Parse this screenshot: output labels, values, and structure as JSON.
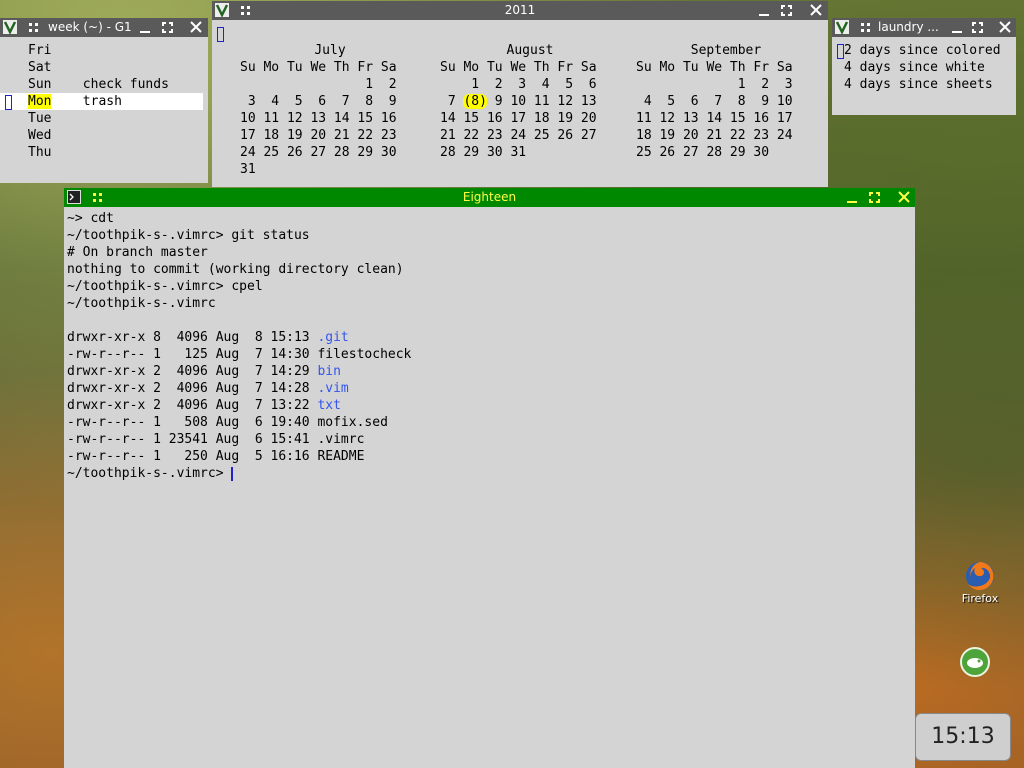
{
  "week_window": {
    "title": "week (~) - G1",
    "rows": [
      {
        "day": "Fri",
        "task": ""
      },
      {
        "day": "Sat",
        "task": ""
      },
      {
        "day": "Sun",
        "task": "check funds"
      },
      {
        "day": "Mon",
        "task": "trash"
      },
      {
        "day": "Tue",
        "task": ""
      },
      {
        "day": "Wed",
        "task": ""
      },
      {
        "day": "Thu",
        "task": ""
      }
    ]
  },
  "calendar_window": {
    "title": "2011",
    "weekday_header": "Su Mo Tu We Th Fr Sa",
    "months": [
      {
        "name": "July",
        "weeks": [
          "                1  2",
          " 3  4  5  6  7  8  9",
          "10 11 12 13 14 15 16",
          "17 18 19 20 21 22 23",
          "24 25 26 27 28 29 30",
          "31"
        ]
      },
      {
        "name": "August",
        "weeks": [
          "    1  2  3  4  5  6",
          " 7 ",
          "14 15 16 17 18 19 20",
          "21 22 23 24 25 26 27",
          "28 29 30 31"
        ]
      },
      {
        "name": "September",
        "weeks": [
          "             1  2  3",
          " 4  5  6  7  8  9 10",
          "11 12 13 14 15 16 17",
          "18 19 20 21 22 23 24",
          "25 26 27 28 29 30"
        ]
      }
    ],
    "today_marker": "(8)",
    "august_week2_rest": " 9 10 11 12 13"
  },
  "laundry_window": {
    "title": "laundry ...",
    "lines": [
      "2 days since colored",
      "4 days since white",
      "4 days since sheets"
    ]
  },
  "terminal": {
    "title": "Eighteen",
    "lines": [
      "~> cdt",
      "~/toothpik-s-.vimrc> git status",
      "# On branch master",
      "nothing to commit (working directory clean)",
      "~/toothpik-s-.vimrc> cpel",
      "~/toothpik-s-.vimrc",
      ""
    ],
    "listing": [
      {
        "meta": "drwxr-xr-x 8  4096 Aug  8 15:13 ",
        "name": ".git",
        "dir": true
      },
      {
        "meta": "-rw-r--r-- 1   125 Aug  7 14:30 ",
        "name": "filestocheck",
        "dir": false
      },
      {
        "meta": "drwxr-xr-x 2  4096 Aug  7 14:29 ",
        "name": "bin",
        "dir": true
      },
      {
        "meta": "drwxr-xr-x 2  4096 Aug  7 14:28 ",
        "name": ".vim",
        "dir": true
      },
      {
        "meta": "drwxr-xr-x 2  4096 Aug  7 13:22 ",
        "name": "txt",
        "dir": true
      },
      {
        "meta": "-rw-r--r-- 1   508 Aug  6 19:40 ",
        "name": "mofix.sed",
        "dir": false
      },
      {
        "meta": "-rw-r--r-- 1 23541 Aug  6 15:41 ",
        "name": ".vimrc",
        "dir": false
      },
      {
        "meta": "-rw-r--r-- 1   250 Aug  5 16:16 ",
        "name": "README",
        "dir": false
      }
    ],
    "prompt": "~/toothpik-s-.vimrc> "
  },
  "desktop": {
    "firefox_label": "Firefox",
    "clock": "15:13"
  },
  "colors": {
    "active_titlebar": "#008800",
    "active_title_text": "#ffff44",
    "inactive_titlebar": "#5a5a5a",
    "directory": "#3355ee",
    "highlight": "#ffff00"
  }
}
